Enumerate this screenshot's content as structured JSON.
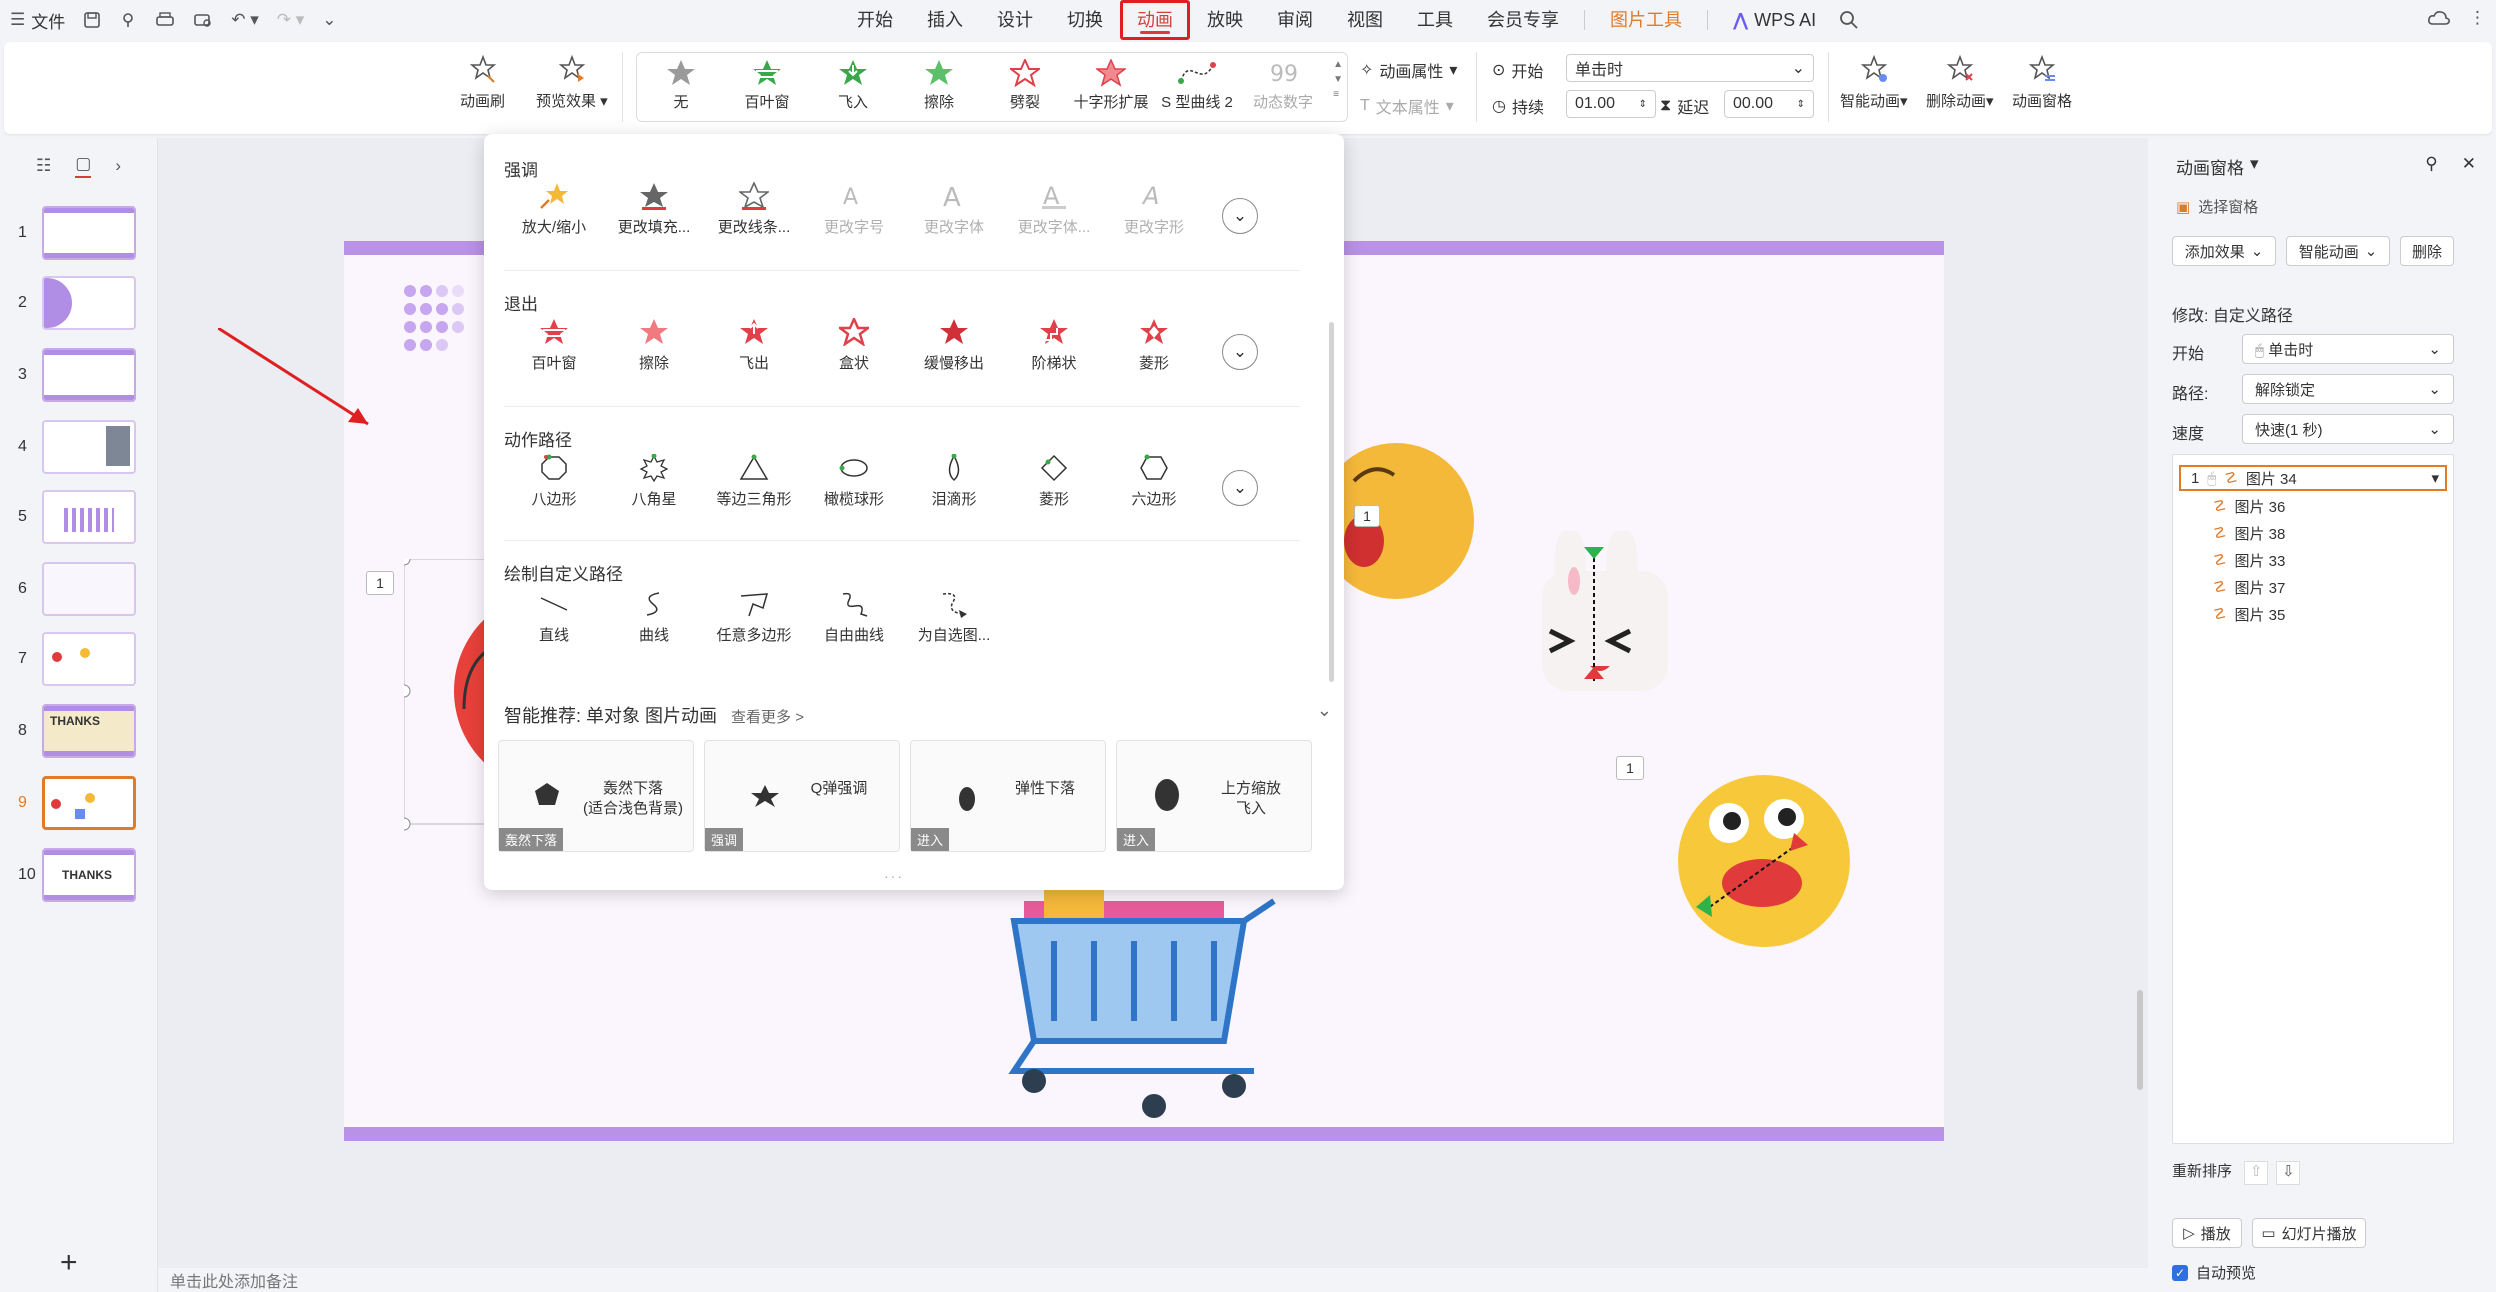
{
  "menubar": {
    "file_label": "文件",
    "tabs": [
      "开始",
      "插入",
      "设计",
      "切换",
      "动画",
      "放映",
      "审阅",
      "视图",
      "工具",
      "会员专享",
      "图片工具"
    ],
    "ai_label": "WPS AI"
  },
  "ribbon": {
    "anim_brush": "动画刷",
    "preview": "预览效果",
    "gallery": [
      "无",
      "百叶窗",
      "飞入",
      "擦除",
      "劈裂",
      "十字形扩展",
      "S 型曲线 2",
      "动态数字"
    ],
    "anim_props": "动画属性",
    "text_props": "文本属性",
    "start_label": "开始",
    "start_value": "单击时",
    "duration_label": "持续",
    "duration_value": "01.00",
    "delay_label": "延迟",
    "delay_value": "00.00",
    "smart_anim": "智能动画",
    "delete_anim": "删除动画",
    "anim_pane": "动画窗格"
  },
  "slides": {
    "numbers": [
      "1",
      "2",
      "3",
      "4",
      "5",
      "6",
      "7",
      "8",
      "9",
      "10"
    ],
    "thanks_label": "THANKS",
    "notes_placeholder": "单击此处添加备注",
    "add_label": "+"
  },
  "dropdown": {
    "emphasis_title": "强调",
    "emphasis": [
      "放大/缩小",
      "更改填充...",
      "更改线条...",
      "更改字号",
      "更改字体",
      "更改字体...",
      "更改字形"
    ],
    "exit_title": "退出",
    "exit": [
      "百叶窗",
      "擦除",
      "飞出",
      "盒状",
      "缓慢移出",
      "阶梯状",
      "菱形"
    ],
    "path_title": "动作路径",
    "path": [
      "八边形",
      "八角星",
      "等边三角形",
      "橄榄球形",
      "泪滴形",
      "菱形",
      "六边形"
    ],
    "custom_title": "绘制自定义路径",
    "custom": [
      "直线",
      "曲线",
      "任意多边形",
      "自由曲线",
      "为自选图..."
    ],
    "rec_title": "智能推荐:",
    "rec_sub": "单对象 图片动画",
    "rec_more": "查看更多 >",
    "rec_cards": [
      {
        "label": "轰然下落\n(适合浅色背景)",
        "tag": "轰然下落"
      },
      {
        "label": "Q弹强调",
        "tag": "强调"
      },
      {
        "label": "弹性下落",
        "tag": "进入"
      },
      {
        "label": "上方缩放\n飞入",
        "tag": "进入"
      }
    ]
  },
  "slide_content": {
    "badge": "1"
  },
  "anim_pane": {
    "title": "动画窗格",
    "select_pane": "选择窗格",
    "add_effect": "添加效果",
    "smart_anim": "智能动画",
    "delete": "删除",
    "modify": "修改: 自定义路径",
    "start_label": "开始",
    "start_value": "单击时",
    "path_label": "路径:",
    "path_value": "解除锁定",
    "speed_label": "速度",
    "speed_value": "快速(1 秒)",
    "items": [
      "图片 34",
      "图片 36",
      "图片 38",
      "图片 33",
      "图片 37",
      "图片 35"
    ],
    "first_index": "1",
    "reorder": "重新排序",
    "play": "播放",
    "slideshow": "幻灯片播放",
    "auto_preview": "自动预览"
  },
  "colors": {
    "accent_red": "#d43f3a",
    "tool_orange": "#e07b2a",
    "slide_band": "#b991e6"
  }
}
